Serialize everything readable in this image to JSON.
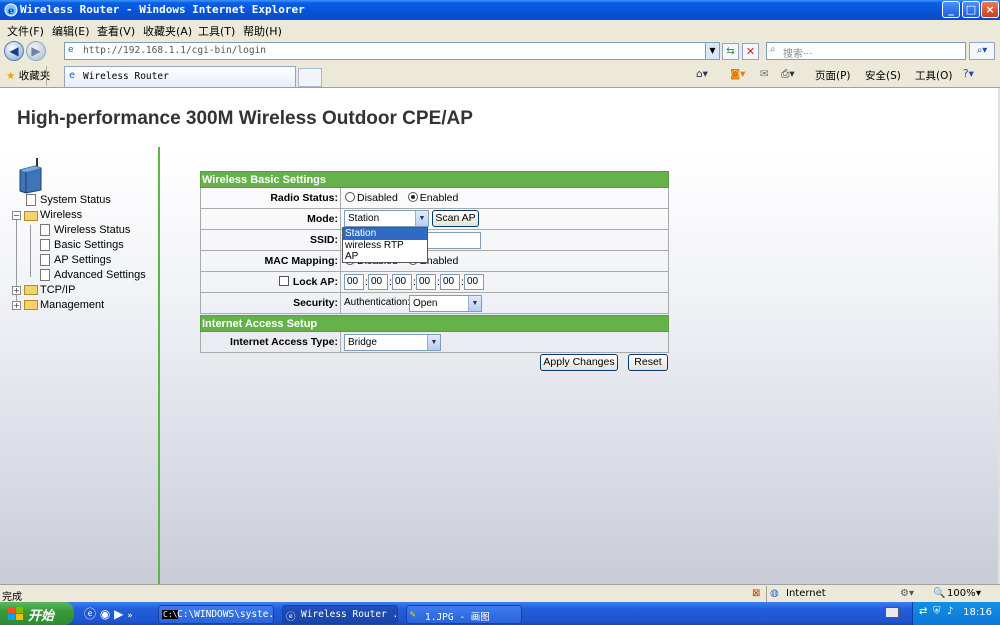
{
  "window": {
    "title": "Wireless Router - Windows Internet Explorer",
    "controls": [
      "_",
      "□",
      "×"
    ]
  },
  "menubar": [
    "文件(F)",
    "编辑(E)",
    "查看(V)",
    "收藏夹(A)",
    "工具(T)",
    "帮助(H)"
  ],
  "address": {
    "url": "http://192.168.1.1/cgi-bin/login",
    "search_placeholder": "搜索···"
  },
  "favorites": {
    "label": "收藏夹",
    "tab_title": "Wireless Router"
  },
  "command_bar": {
    "page": "页面(P)",
    "safety": "安全(S)",
    "tools": "工具(O)"
  },
  "page": {
    "heading": "High-performance 300M Wireless Outdoor CPE/AP"
  },
  "tree": {
    "system_status": "System Status",
    "wireless": "Wireless",
    "wireless_status": "Wireless Status",
    "basic_settings": "Basic Settings",
    "ap_settings": "AP Settings",
    "advanced_settings": "Advanced Settings",
    "tcpip": "TCP/IP",
    "management": "Management"
  },
  "form": {
    "section1": "Wireless Basic Settings",
    "radio_status_label": "Radio Status:",
    "radio_disabled": "Disabled",
    "radio_enabled": "Enabled",
    "radio_selected": "Enabled",
    "mode_label": "Mode:",
    "mode_value": "Station",
    "scan_ap": "Scan AP",
    "mode_options": [
      "Station",
      "wireless RTP",
      "AP"
    ],
    "ssid_label": "SSID:",
    "mac_mapping_label": "MAC Mapping:",
    "mac_disabled": "Disabled",
    "mac_enabled": "Enabled",
    "lock_ap_label": "Lock AP:",
    "mac_octets": [
      "00",
      "00",
      "00",
      "00",
      "00",
      "00"
    ],
    "security_label": "Security:",
    "auth_label": "Authentication:",
    "auth_value": "Open",
    "section2": "Internet Access Setup",
    "access_type_label": "Internet Access Type:",
    "access_type_value": "Bridge",
    "apply": "Apply Changes",
    "reset": "Reset"
  },
  "statusbar": {
    "text": "完成",
    "zone": "Internet",
    "zoom": "100%"
  },
  "taskbar": {
    "start": "开始",
    "tasks": [
      "C:\\WINDOWS\\syste...",
      "Wireless Router ...",
      "1.JPG - 画图"
    ],
    "clock": "18:16"
  }
}
